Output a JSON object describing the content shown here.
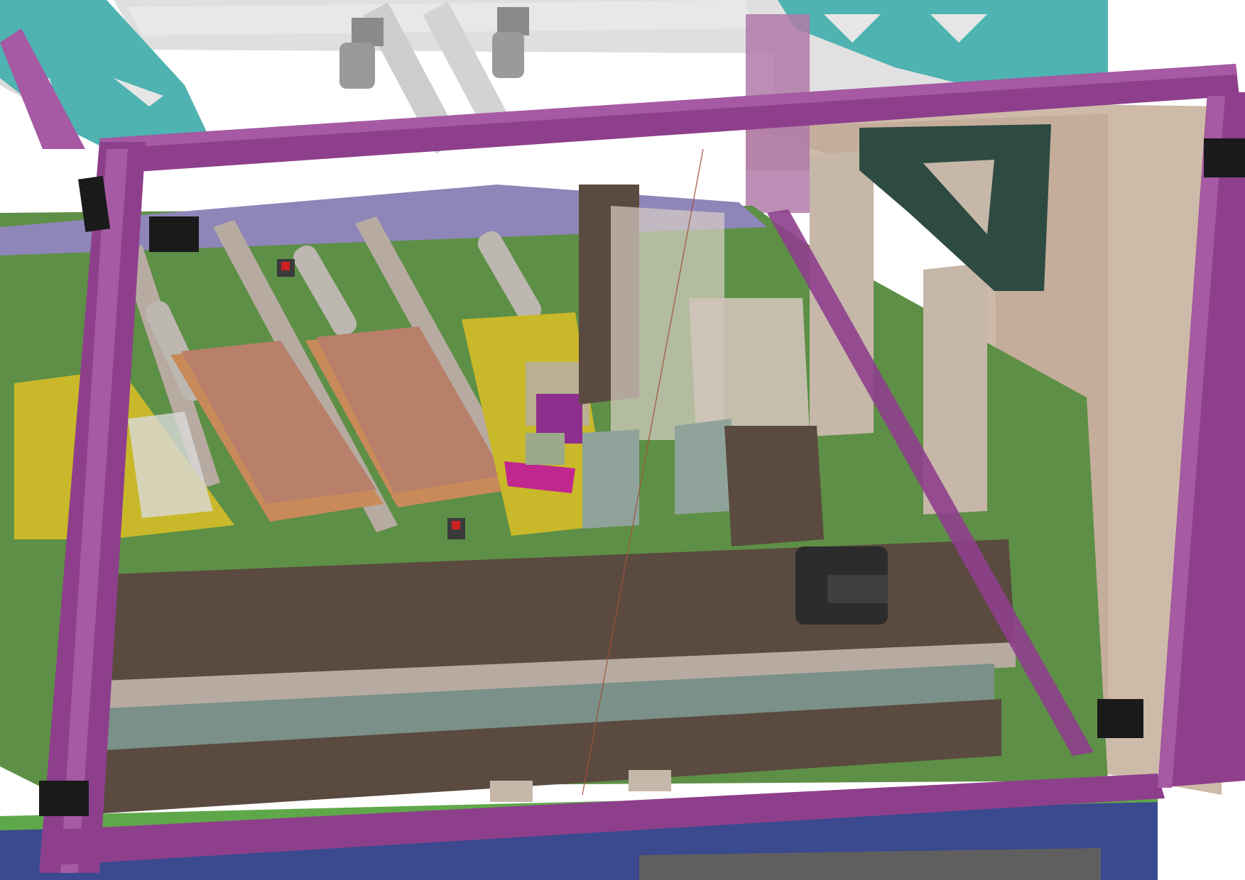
{
  "scene": {
    "kind": "3D CAD assembly view of an enclosed automation machine",
    "colors": {
      "background": "#ffffff",
      "frame_profile": "#8e3f8c",
      "frame_profile_light": "#a55aa3",
      "corner_bracket_teal": "#4fb3b1",
      "corner_bracket_dark": "#2e4b42",
      "base_plate_green": "#5e8f46",
      "linear_module_brown": "#5a4a3f",
      "fixture_tray_pink": "#b8806a",
      "fixture_tray_orange": "#c98a5a",
      "clamp_yellow": "#c9b82a",
      "gripper_magenta": "#c0278f",
      "motor_black": "#2c2c2c",
      "side_panel_tan": "#c9b2a0",
      "guide_rail_grey": "#b7aba1",
      "floor_blue": "#3b4a8e",
      "hinge_black": "#1a1a1a",
      "transparent_upper_frame": "#cfcfcf"
    },
    "components": [
      "front-door-frame",
      "top-corner-brackets",
      "hinges",
      "linear-gantry-module",
      "servo-motor",
      "vertical-z-axis",
      "fixture-trays",
      "clamp-station",
      "gripper-head",
      "guide-rails",
      "pneumatic-cylinders",
      "side-panel",
      "base-plate"
    ]
  }
}
